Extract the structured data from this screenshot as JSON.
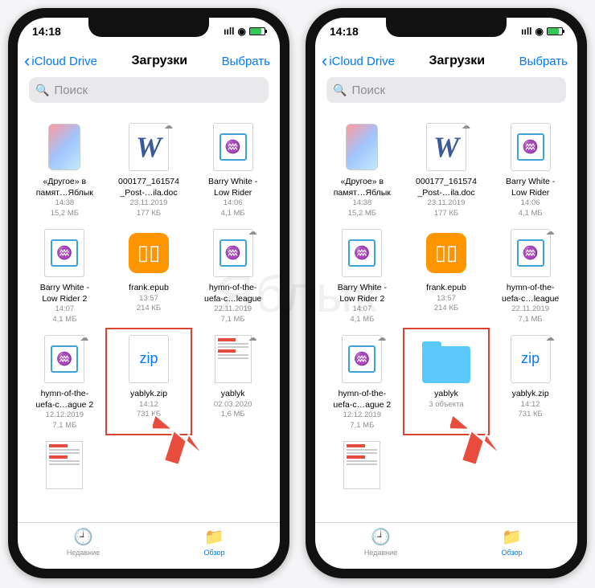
{
  "watermark": "Яблык",
  "phones": [
    {
      "status": {
        "time": "14:18"
      },
      "nav": {
        "back": "iCloud Drive",
        "title": "Загрузки",
        "select": "Выбрать"
      },
      "search": {
        "placeholder": "Поиск"
      },
      "files": [
        {
          "type": "iphone",
          "name": "«Другое» в",
          "name2": "памят…Яблык",
          "date": "14:38",
          "size": "15,2 МБ",
          "cloud": false
        },
        {
          "type": "word",
          "name": "000177_161574",
          "name2": "_Post-…ila.doc",
          "date": "23.11.2019",
          "size": "177 КБ",
          "cloud": true
        },
        {
          "type": "audio",
          "name": "Barry White -",
          "name2": "Low Rider",
          "date": "14:06",
          "size": "4,1 МБ",
          "cloud": false
        },
        {
          "type": "audio",
          "name": "Barry White -",
          "name2": "Low Rider 2",
          "date": "14:07",
          "size": "4,1 МБ",
          "cloud": false
        },
        {
          "type": "ibooks",
          "name": "frank.epub",
          "name2": "",
          "date": "13:57",
          "size": "214 КБ",
          "cloud": false
        },
        {
          "type": "audio",
          "name": "hymn-of-the-",
          "name2": "uefa-c…league",
          "date": "22.11.2019",
          "size": "7,1 МБ",
          "cloud": true
        },
        {
          "type": "audio",
          "name": "hymn-of-the-",
          "name2": "uefa-c…ague 2",
          "date": "12.12.2019",
          "size": "7,1 МБ",
          "cloud": true
        },
        {
          "type": "zip",
          "name": "yablyk.zip",
          "name2": "",
          "date": "14:12",
          "size": "731 КБ",
          "cloud": false,
          "hl": true
        },
        {
          "type": "page",
          "name": "yablyk",
          "name2": "",
          "date": "02.03.2020",
          "size": "1,6 МБ",
          "cloud": true
        },
        {
          "type": "page",
          "name": "",
          "name2": "",
          "date": "",
          "size": "",
          "cloud": false
        }
      ],
      "tabs": {
        "recent": "Недавние",
        "browse": "Обзор"
      }
    },
    {
      "status": {
        "time": "14:18"
      },
      "nav": {
        "back": "iCloud Drive",
        "title": "Загрузки",
        "select": "Выбрать"
      },
      "search": {
        "placeholder": "Поиск"
      },
      "files": [
        {
          "type": "iphone",
          "name": "«Другое» в",
          "name2": "памят…Яблык",
          "date": "14:38",
          "size": "15,2 МБ",
          "cloud": false
        },
        {
          "type": "word",
          "name": "000177_161574",
          "name2": "_Post-…ila.doc",
          "date": "23.11.2019",
          "size": "177 КБ",
          "cloud": true
        },
        {
          "type": "audio",
          "name": "Barry White -",
          "name2": "Low Rider",
          "date": "14:06",
          "size": "4,1 МБ",
          "cloud": false
        },
        {
          "type": "audio",
          "name": "Barry White -",
          "name2": "Low Rider 2",
          "date": "14:07",
          "size": "4,1 МБ",
          "cloud": false
        },
        {
          "type": "ibooks",
          "name": "frank.epub",
          "name2": "",
          "date": "13:57",
          "size": "214 КБ",
          "cloud": false
        },
        {
          "type": "audio",
          "name": "hymn-of-the-",
          "name2": "uefa-c…league",
          "date": "22.11.2019",
          "size": "7,1 МБ",
          "cloud": true
        },
        {
          "type": "audio",
          "name": "hymn-of-the-",
          "name2": "uefa-c…ague 2",
          "date": "12.12.2019",
          "size": "7,1 МБ",
          "cloud": true
        },
        {
          "type": "folder",
          "name": "yablyk",
          "name2": "",
          "date": "3 объекта",
          "size": "",
          "cloud": false,
          "hl": true
        },
        {
          "type": "zip",
          "name": "yablyk.zip",
          "name2": "",
          "date": "14:12",
          "size": "731 КБ",
          "cloud": true
        },
        {
          "type": "page",
          "name": "",
          "name2": "",
          "date": "",
          "size": "",
          "cloud": false
        }
      ],
      "tabs": {
        "recent": "Недавние",
        "browse": "Обзор"
      }
    }
  ]
}
